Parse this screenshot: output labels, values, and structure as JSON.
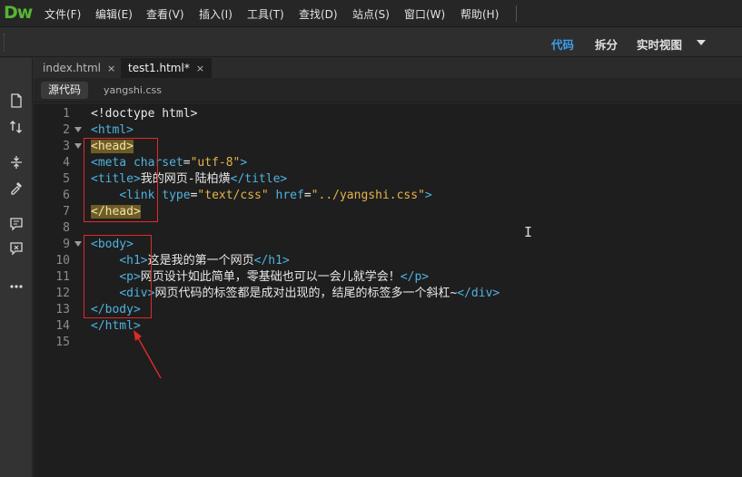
{
  "app": {
    "logo": "Dw"
  },
  "menu": [
    "文件(F)",
    "编辑(E)",
    "查看(V)",
    "插入(I)",
    "工具(T)",
    "查找(D)",
    "站点(S)",
    "窗口(W)",
    "帮助(H)"
  ],
  "view_modes": {
    "code": "代码",
    "split": "拆分",
    "live": "实时视图",
    "active": "代码"
  },
  "tabs": [
    {
      "label": "index.html",
      "close": "×"
    },
    {
      "label": "test1.html*",
      "close": "×",
      "active": true
    }
  ],
  "related_files": {
    "source": "源代码",
    "css": "yangshi.css"
  },
  "tools": [
    "file-management-icon",
    "get-put-icon",
    "expand-collapse-icon",
    "format-icon",
    "comment-icon",
    "code-hint-icon",
    "more-icon"
  ],
  "code": {
    "lines": [
      {
        "n": "1",
        "fold": false,
        "parts": [
          [
            "tx",
            "<!doctype html>"
          ]
        ]
      },
      {
        "n": "2",
        "fold": true,
        "parts": [
          [
            "tg",
            "<html>"
          ]
        ]
      },
      {
        "n": "3",
        "fold": true,
        "parts": [
          [
            "hl",
            "<head>"
          ]
        ]
      },
      {
        "n": "4",
        "fold": false,
        "parts": [
          [
            "tg",
            "<meta "
          ],
          [
            "at",
            "charset"
          ],
          [
            "tx",
            "="
          ],
          [
            "vl",
            "\"utf-8\""
          ],
          [
            "tg",
            ">"
          ]
        ]
      },
      {
        "n": "5",
        "fold": false,
        "parts": [
          [
            "tg",
            "<title>"
          ],
          [
            "tx",
            "我的网页-陆柏熿"
          ],
          [
            "tg",
            "</title>"
          ]
        ]
      },
      {
        "n": "6",
        "fold": false,
        "parts": [
          [
            "tx",
            "    "
          ],
          [
            "tg",
            "<link "
          ],
          [
            "at",
            "type"
          ],
          [
            "tx",
            "="
          ],
          [
            "vl",
            "\"text/css\""
          ],
          [
            "tx",
            " "
          ],
          [
            "at",
            "href"
          ],
          [
            "tx",
            "="
          ],
          [
            "vl",
            "\"../yangshi.css\""
          ],
          [
            "tg",
            ">"
          ]
        ]
      },
      {
        "n": "7",
        "fold": false,
        "parts": [
          [
            "hl",
            "</head>"
          ]
        ]
      },
      {
        "n": "8",
        "fold": false,
        "parts": []
      },
      {
        "n": "9",
        "fold": true,
        "parts": [
          [
            "tg",
            "<body>"
          ]
        ]
      },
      {
        "n": "10",
        "fold": false,
        "parts": [
          [
            "tx",
            "    "
          ],
          [
            "tg",
            "<h1>"
          ],
          [
            "tx",
            "这是我的第一个网页"
          ],
          [
            "tg",
            "</h1>"
          ]
        ]
      },
      {
        "n": "11",
        "fold": false,
        "parts": [
          [
            "tx",
            "    "
          ],
          [
            "tg",
            "<p>"
          ],
          [
            "tx",
            "网页设计如此简单，零基础也可以一会儿就学会！"
          ],
          [
            "tg",
            "</p>"
          ]
        ]
      },
      {
        "n": "12",
        "fold": false,
        "parts": [
          [
            "tx",
            "    "
          ],
          [
            "tg",
            "<div>"
          ],
          [
            "tx",
            "网页代码的标签都是成对出现的，结尾的标签多一个斜杠~"
          ],
          [
            "tg",
            "</div>"
          ]
        ]
      },
      {
        "n": "13",
        "fold": false,
        "parts": [
          [
            "tg",
            "</body>"
          ]
        ]
      },
      {
        "n": "14",
        "fold": false,
        "parts": [
          [
            "tg",
            "</html>"
          ]
        ]
      },
      {
        "n": "15",
        "fold": false,
        "parts": []
      }
    ]
  },
  "colors": {
    "accent": "#3c9ee8",
    "logo": "#55b533",
    "annotation": "#e02a2a",
    "tag": "#4eb3e0",
    "value": "#e4b44a"
  }
}
